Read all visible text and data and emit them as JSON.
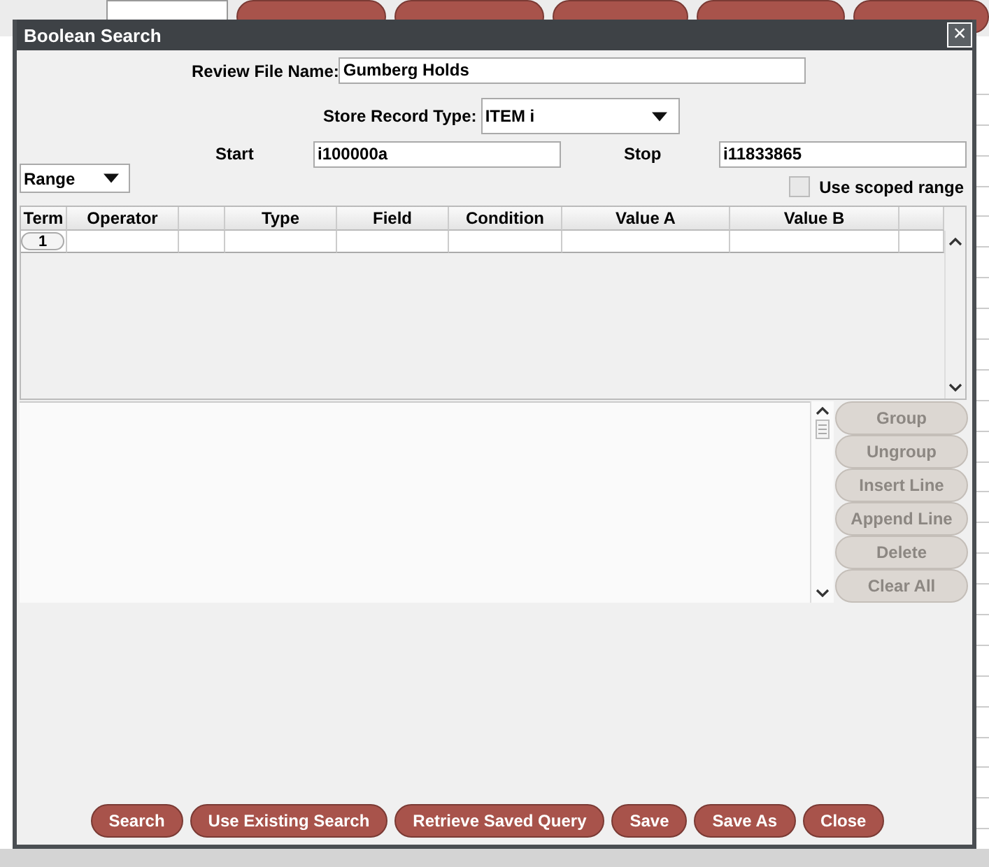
{
  "window": {
    "title": "Boolean Search",
    "close": "×"
  },
  "review_file": {
    "label": "Review File Name:",
    "value": "Gumberg Holds"
  },
  "record_type": {
    "label": "Store Record Type:",
    "value": "ITEM  i"
  },
  "range_mode": {
    "value": "Range"
  },
  "start": {
    "label": "Start",
    "value": "i100000a"
  },
  "stop": {
    "label": "Stop",
    "value": "i11833865"
  },
  "scoped_range": {
    "label": "Use scoped range",
    "checked": false
  },
  "table": {
    "columns": [
      "Term",
      "Operator",
      "",
      "Type",
      "Field",
      "Condition",
      "Value A",
      "Value B",
      ""
    ],
    "rows": [
      {
        "term": "1"
      }
    ]
  },
  "side_buttons": [
    {
      "label": "Group",
      "disabled": true
    },
    {
      "label": "Ungroup",
      "disabled": true
    },
    {
      "label": "Insert Line",
      "disabled": true
    },
    {
      "label": "Append Line",
      "disabled": true
    },
    {
      "label": "Delete",
      "disabled": true
    },
    {
      "label": "Clear All",
      "disabled": true
    }
  ],
  "buttons": [
    "Search",
    "Use Existing Search",
    "Retrieve Saved Query",
    "Save",
    "Save As",
    "Close"
  ]
}
